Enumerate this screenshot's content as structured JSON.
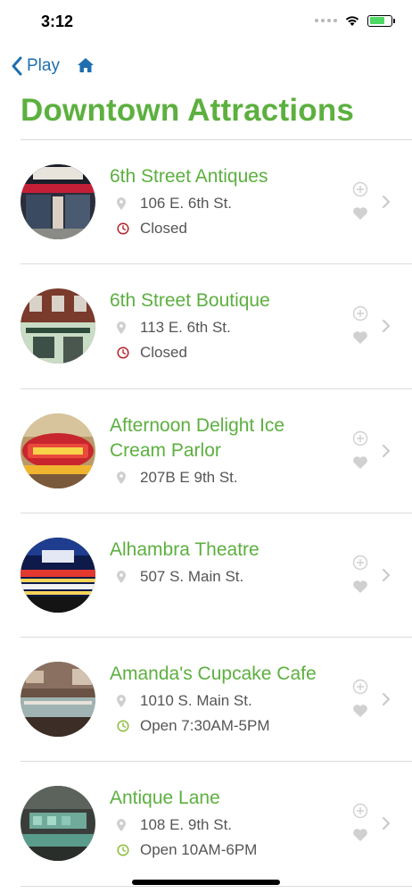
{
  "status": {
    "time": "3:12"
  },
  "nav": {
    "back_label": "Play"
  },
  "page": {
    "title": "Downtown Attractions"
  },
  "colors": {
    "accent_green": "#5cb03f",
    "link_blue": "#1f6fb0",
    "closed_red": "#b3232a",
    "open_green": "#8bbf3c",
    "muted_gray": "#c7c7c7"
  },
  "icons": {
    "location": "map-pin-icon",
    "hours": "clock-icon",
    "add": "plus-circle-icon",
    "favorite": "heart-icon",
    "open": "chevron-right-icon"
  },
  "items": [
    {
      "name": "6th Street Antiques",
      "address": "106 E. 6th St.",
      "hours": "Closed",
      "status": "closed"
    },
    {
      "name": "6th Street Boutique",
      "address": "113 E. 6th St.",
      "hours": "Closed",
      "status": "closed"
    },
    {
      "name": "Afternoon Delight Ice Cream Parlor",
      "address": "207B E 9th St.",
      "hours": "",
      "status": "none"
    },
    {
      "name": "Alhambra Theatre",
      "address": "507 S. Main St.",
      "hours": "",
      "status": "none"
    },
    {
      "name": "Amanda's Cupcake Cafe",
      "address": "1010 S. Main St.",
      "hours": "Open 7:30AM-5PM",
      "status": "open"
    },
    {
      "name": "Antique Lane",
      "address": "108 E. 9th St.",
      "hours": "Open 10AM-6PM",
      "status": "open"
    }
  ]
}
